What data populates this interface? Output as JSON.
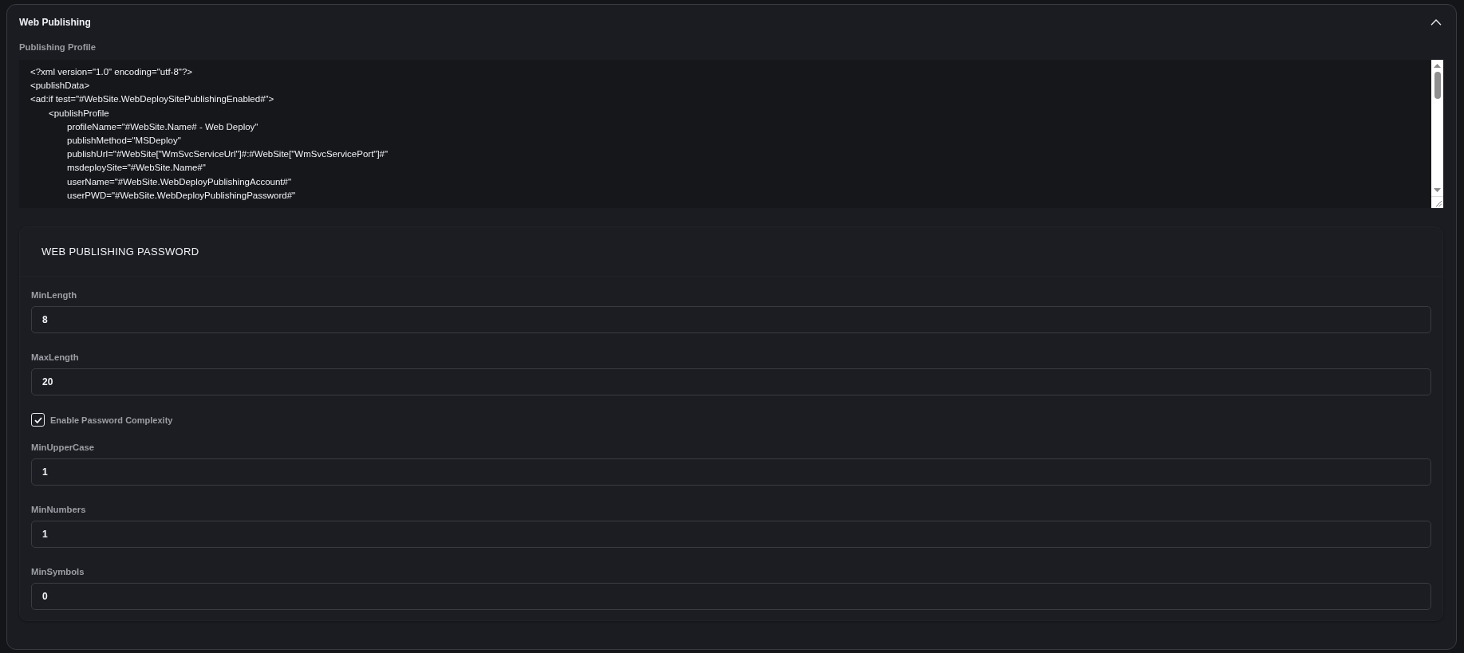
{
  "panel": {
    "title": "Web Publishing",
    "expanded": true
  },
  "publishing_profile": {
    "label": "Publishing Profile",
    "value": "<?xml version=\"1.0\" encoding=\"utf-8\"?>\n<publishData>\n<ad:if test=\"#WebSite.WebDeploySitePublishingEnabled#\">\n\t<publishProfile\n\t\tprofileName=\"#WebSite.Name# - Web Deploy\"\n\t\tpublishMethod=\"MSDeploy\"\n\t\tpublishUrl=\"#WebSite[\"WmSvcServiceUrl\"]#:#WebSite[\"WmSvcServicePort\"]#\"\n\t\tmsdeploySite=\"#WebSite.Name#\"\n\t\tuserName=\"#WebSite.WebDeployPublishingAccount#\"\n\t\tuserPWD=\"#WebSite.WebDeployPublishingPassword#\""
  },
  "password_section": {
    "title": "WEB PUBLISHING PASSWORD",
    "items": [
      {
        "kind": "field",
        "label": "MinLength",
        "value": "8"
      },
      {
        "kind": "field",
        "label": "MaxLength",
        "value": "20"
      },
      {
        "kind": "checkbox",
        "label": "Enable Password Complexity",
        "checked": true
      },
      {
        "kind": "field",
        "label": "MinUpperCase",
        "value": "1"
      },
      {
        "kind": "field",
        "label": "MinNumbers",
        "value": "1"
      },
      {
        "kind": "field",
        "label": "MinSymbols",
        "value": "0"
      }
    ]
  }
}
